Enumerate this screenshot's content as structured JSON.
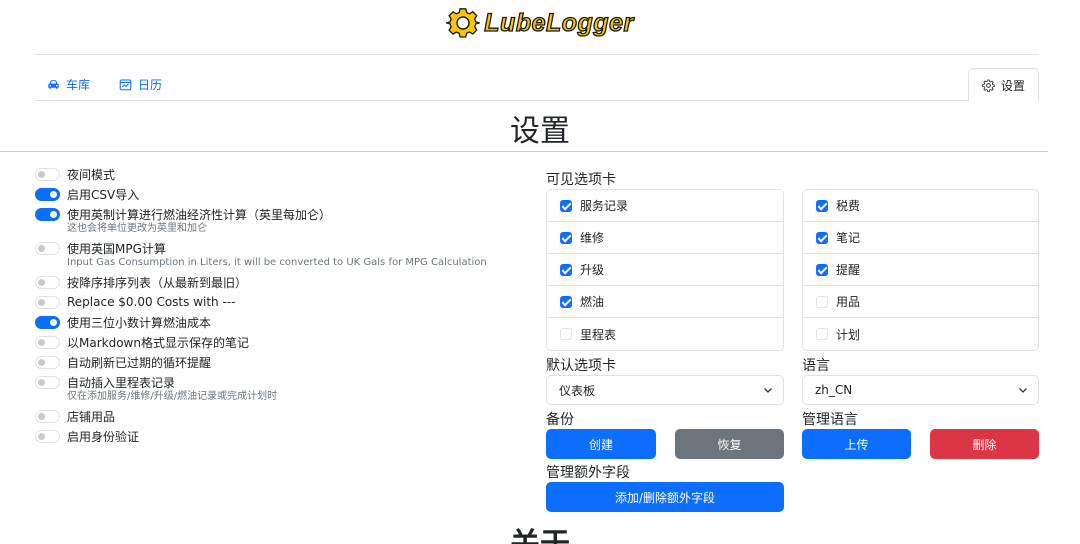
{
  "brand": {
    "name": "LubeLogger",
    "accent_color": "#ffc400"
  },
  "nav": {
    "garage": {
      "label": "车库",
      "icon": "car-icon"
    },
    "calendar": {
      "label": "日历",
      "icon": "calendar-icon"
    },
    "settings": {
      "label": "设置",
      "icon": "gear-icon"
    }
  },
  "page": {
    "title": "设置",
    "about_title": "关于"
  },
  "settings": [
    {
      "label": "夜间模式",
      "on": false
    },
    {
      "label": "启用CSV导入",
      "on": true
    },
    {
      "label": "使用英制计算进行燃油经济性计算（英里每加仑）",
      "on": true,
      "help": "这也会将单位更改为英里和加仑"
    },
    {
      "label": "使用英国MPG计算",
      "on": false,
      "help": "Input Gas Consumption in Liters, it will be converted to UK Gals for MPG Calculation"
    },
    {
      "label": "按降序排序列表（从最新到最旧）",
      "on": false
    },
    {
      "label": "Replace $0.00 Costs with ---",
      "on": false
    },
    {
      "label": "使用三位小数计算燃油成本",
      "on": true
    },
    {
      "label": "以Markdown格式显示保存的笔记",
      "on": false
    },
    {
      "label": "自动刷新已过期的循环提醒",
      "on": false
    },
    {
      "label": "自动插入里程表记录",
      "on": false,
      "help": "仅在添加服务/维修/升级/燃油记录或完成计划时"
    },
    {
      "label": "店铺用品",
      "on": false
    },
    {
      "label": "启用身份验证",
      "on": false
    }
  ],
  "visible_tabs": {
    "label": "可见选项卡",
    "left": [
      {
        "label": "服务记录",
        "checked": true
      },
      {
        "label": "维修",
        "checked": true
      },
      {
        "label": "升级",
        "checked": true
      },
      {
        "label": "燃油",
        "checked": true
      },
      {
        "label": "里程表",
        "checked": false
      }
    ],
    "right": [
      {
        "label": "税费",
        "checked": true
      },
      {
        "label": "笔记",
        "checked": true
      },
      {
        "label": "提醒",
        "checked": true
      },
      {
        "label": "用品",
        "checked": false
      },
      {
        "label": "计划",
        "checked": false
      }
    ]
  },
  "default_tab": {
    "label": "默认选项卡",
    "value": "仪表板"
  },
  "language": {
    "label": "语言",
    "value": "zh_CN"
  },
  "backup": {
    "label": "备份",
    "create": "创建",
    "restore": "恢复"
  },
  "manage_language": {
    "label": "管理语言",
    "upload": "上传",
    "delete": "删除"
  },
  "extra_fields": {
    "label": "管理额外字段",
    "button": "添加/删除额外字段"
  }
}
